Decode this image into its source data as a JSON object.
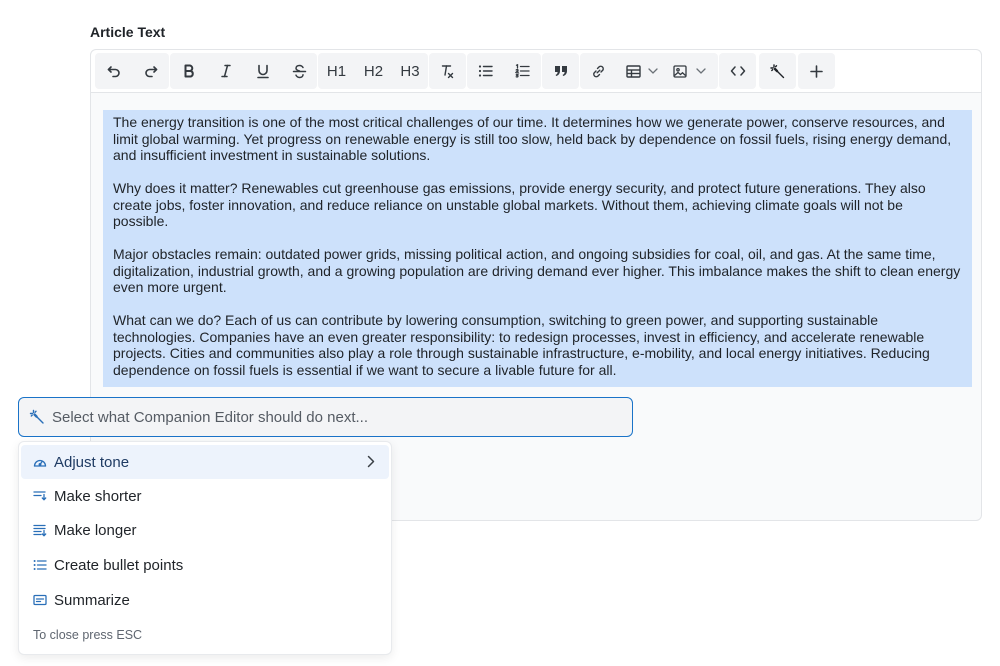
{
  "field": {
    "label": "Article Text"
  },
  "toolbar": {
    "undo_icon": "undo-icon",
    "redo_icon": "redo-icon",
    "bold_icon": "bold-icon",
    "italic_icon": "italic-icon",
    "underline_icon": "underline-icon",
    "strikethrough_icon": "strikethrough-icon",
    "h1": "H1",
    "h2": "H2",
    "h3": "H3",
    "clear_format_icon": "clear-format-icon",
    "bullet_list_icon": "bullet-list-icon",
    "numbered_list_icon": "numbered-list-icon",
    "blockquote_icon": "blockquote-icon",
    "link_icon": "link-icon",
    "table_icon": "table-icon",
    "image_icon": "image-icon",
    "code_icon": "code-icon",
    "ai_wand_icon": "magic-wand-icon",
    "insert_icon": "plus-icon"
  },
  "content": {
    "selection_color": "#cde1fb",
    "paragraphs": [
      "The energy transition is one of the most critical challenges of our time. It determines how we generate power, conserve resources, and limit global warming. Yet progress on renewable energy is still too slow, held back by dependence on fossil fuels, rising energy demand, and insufficient investment in sustainable solutions.",
      "Why does it matter? Renewables cut greenhouse gas emissions, provide energy security, and protect future generations. They also create jobs, foster innovation, and reduce reliance on unstable global markets. Without them, achieving climate goals will not be possible.",
      "Major obstacles remain: outdated power grids, missing political action, and ongoing subsidies for coal, oil, and gas. At the same time, digitalization, industrial growth, and a growing population are driving demand ever higher. This imbalance makes the shift to clean energy even more urgent.",
      "What can we do? Each of us can contribute by lowering consumption, switching to green power, and supporting sustainable technologies. Companies have an even greater responsibility: to redesign processes, invest in efficiency, and accelerate renewable projects. Cities and communities also play a role through sustainable infrastructure, e-mobility, and local energy initiatives. Reducing dependence on fossil fuels is essential if we want to secure a livable future for all."
    ]
  },
  "ai": {
    "placeholder": "Select what Companion Editor should do next...",
    "accent": "#1a73c8",
    "menu": [
      {
        "label": "Adjust tone",
        "icon": "gauge-icon",
        "active": true,
        "has_submenu": true
      },
      {
        "label": "Make shorter",
        "icon": "shorten-text-icon"
      },
      {
        "label": "Make longer",
        "icon": "lengthen-text-icon"
      },
      {
        "label": "Create bullet points",
        "icon": "bullet-list-icon"
      },
      {
        "label": "Summarize",
        "icon": "summary-card-icon"
      }
    ],
    "hint": "To close press ESC"
  }
}
